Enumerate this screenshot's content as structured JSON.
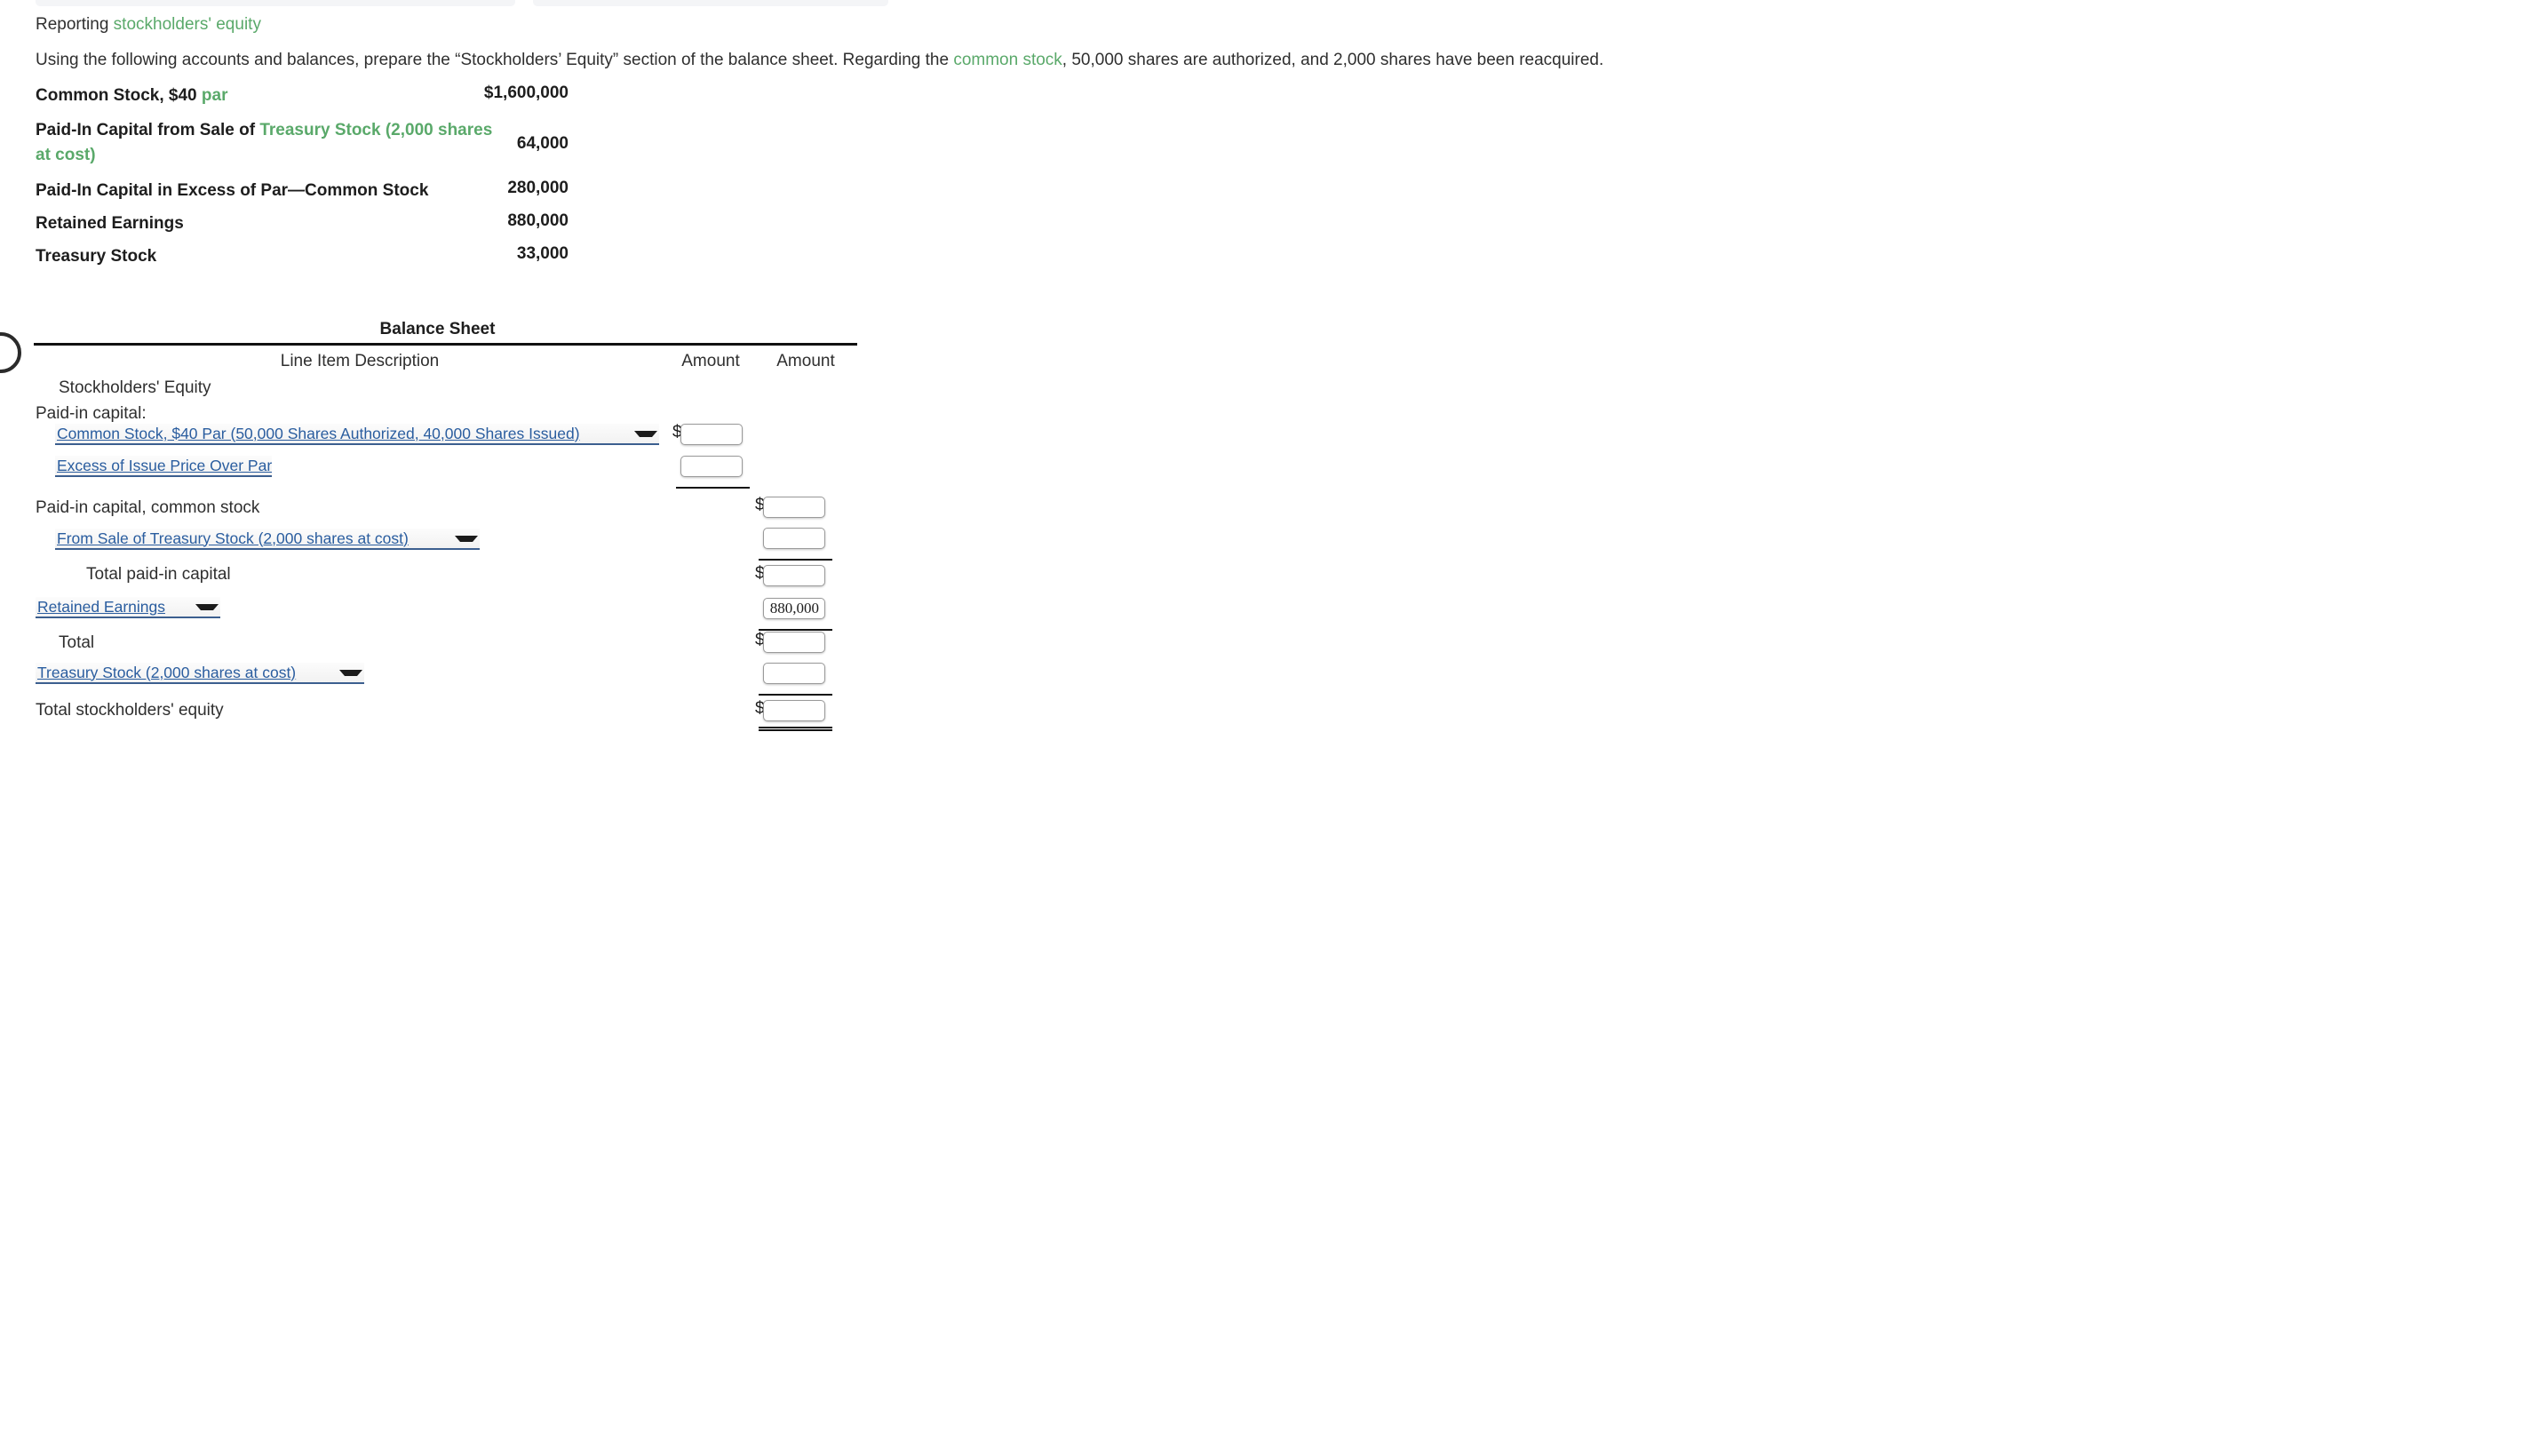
{
  "intro": {
    "title_prefix": "Reporting ",
    "title_link": "stockholders' equity",
    "paragraph_part1": "Using the following accounts and balances, prepare the “Stockholders’ Equity” section of the balance sheet. Regarding the ",
    "paragraph_link": "common stock",
    "paragraph_part2": ", 50,000 shares are authorized, and 2,000 shares have been reacquired."
  },
  "given_accounts": [
    {
      "label_plain": "Common Stock, $40 ",
      "label_link": "par",
      "label_tail": "",
      "amount": "$1,600,000"
    },
    {
      "label_plain": "Paid-In Capital from Sale of ",
      "label_link": "Treasury Stock (2,000 shares at cost)",
      "label_tail": "",
      "amount": "64,000"
    },
    {
      "label_plain": "Paid-In Capital in Excess of Par—Common Stock",
      "label_link": "",
      "label_tail": "",
      "amount": "280,000"
    },
    {
      "label_plain": "Retained Earnings",
      "label_link": "",
      "label_tail": "",
      "amount": "880,000"
    },
    {
      "label_plain": "Treasury Stock",
      "label_link": "",
      "label_tail": "",
      "amount": "33,000"
    }
  ],
  "balance_sheet": {
    "title": "Balance Sheet",
    "columns": {
      "description": "Line Item Description",
      "amount1": "Amount",
      "amount2": "Amount"
    },
    "rows": {
      "stockholders_equity": "Stockholders' Equity",
      "paid_in_capital": "Paid-in capital:",
      "paid_in_capital_common_stock": "Paid-in capital, common stock",
      "total_paid_in_capital": "Total paid-in capital",
      "total": "Total",
      "total_stockholders_equity": "Total stockholders' equity"
    },
    "selects": {
      "common_stock": "Common Stock, $40 Par (50,000 Shares Authorized, 40,000 Shares Issued)",
      "excess_issue_price": "Excess of Issue Price Over Par",
      "from_sale_treasury": "From Sale of Treasury Stock (2,000 shares at cost)",
      "retained_earnings": "Retained Earnings",
      "treasury_stock": "Treasury Stock (2,000 shares at cost)"
    },
    "inputs": {
      "common_stock_amount": "",
      "excess_issue_price_amount": "",
      "paid_in_capital_common_stock_amount": "",
      "from_sale_treasury_amount": "",
      "total_paid_in_capital_amount": "",
      "retained_earnings_amount": "880,000",
      "total_amount": "",
      "treasury_stock_amount": "",
      "total_stockholders_equity_amount": ""
    },
    "currency_symbol": "$"
  },
  "colors": {
    "link_green": "#5aa96a",
    "select_blue": "#2a5d9f",
    "text": "#2f2f2f"
  }
}
